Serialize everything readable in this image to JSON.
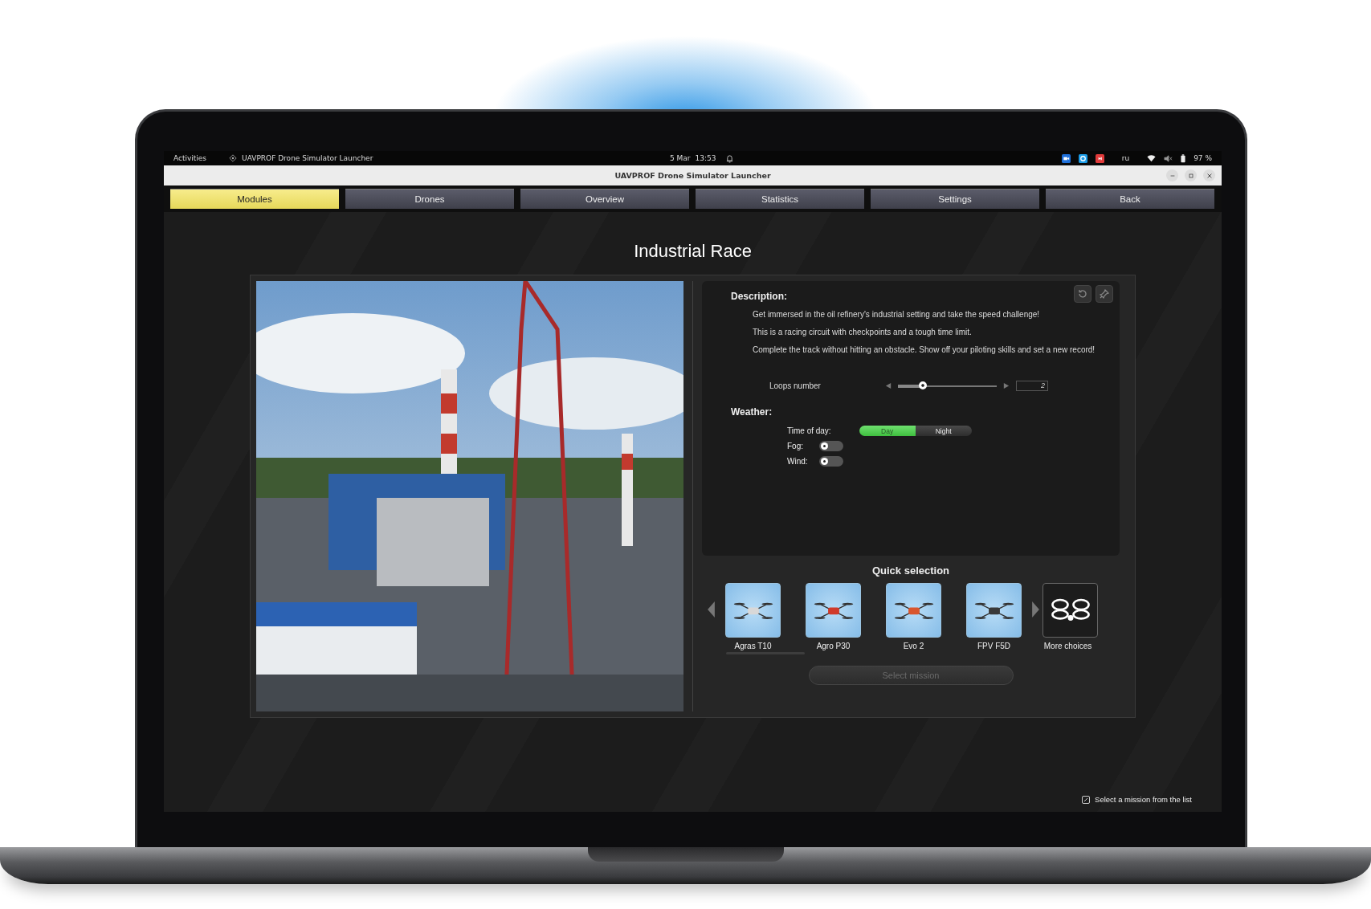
{
  "system_bar": {
    "activities": "Activities",
    "app_name": "UAVPROF Drone Simulator Launcher",
    "date": "5 Mar",
    "time": "13:53",
    "keyboard_layout": "ru",
    "battery": "97 %"
  },
  "window": {
    "title": "UAVPROF Drone Simulator Launcher"
  },
  "tabs": [
    {
      "label": "Modules",
      "selected": true
    },
    {
      "label": "Drones",
      "selected": false
    },
    {
      "label": "Overview",
      "selected": false
    },
    {
      "label": "Statistics",
      "selected": false
    },
    {
      "label": "Settings",
      "selected": false
    },
    {
      "label": "Back",
      "selected": false
    }
  ],
  "mission": {
    "title": "Industrial Race",
    "description_label": "Description:",
    "description": [
      "Get immersed in the oil refinery's industrial setting and take the speed challenge!",
      "This is a racing circuit with checkpoints and a tough time limit.",
      "Complete the track without hitting an obstacle. Show off your piloting skills and set a new record!"
    ],
    "loops": {
      "label": "Loops number",
      "level": 0.25,
      "value": "2"
    },
    "weather": {
      "label": "Weather:",
      "time_of_day": {
        "label": "Time of day:",
        "options": [
          {
            "label": "Day",
            "selected": true
          },
          {
            "label": "Night",
            "selected": false
          }
        ]
      },
      "toggles": [
        {
          "label": "Fog:",
          "on": false
        },
        {
          "label": "Wind:",
          "on": false
        }
      ]
    }
  },
  "quick_selection": {
    "title": "Quick selection",
    "drones": [
      {
        "name": "Agras T10",
        "kind": "agri"
      },
      {
        "name": "Agro P30",
        "kind": "agri-red"
      },
      {
        "name": "Evo 2",
        "kind": "camera"
      },
      {
        "name": "FPV F5D",
        "kind": "fpv"
      }
    ],
    "more": "More choices",
    "select_button": {
      "label": "Select mission",
      "disabled": true
    }
  },
  "status": "Select a mission from the list"
}
